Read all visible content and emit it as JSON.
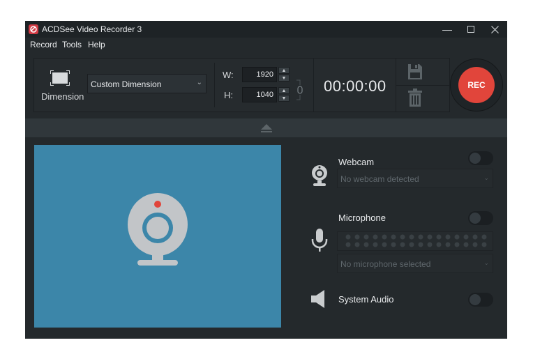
{
  "window": {
    "title": "ACDSee Video Recorder 3"
  },
  "menu": [
    "Record",
    "Tools",
    "Help"
  ],
  "toolbar": {
    "dimension_label": "Dimension",
    "dimension_value": "Custom Dimension",
    "width_label": "W:",
    "width_value": "1920",
    "height_label": "H:",
    "height_value": "1040",
    "timer": "00:00:00",
    "rec_label": "REC"
  },
  "sources": {
    "webcam": {
      "label": "Webcam",
      "dropdown": "No webcam detected",
      "enabled": false
    },
    "microphone": {
      "label": "Microphone",
      "dropdown": "No microphone selected",
      "enabled": false
    },
    "system_audio": {
      "label": "System Audio",
      "enabled": false
    }
  },
  "colors": {
    "accent_rec": "#e1453b",
    "preview_bg": "#3c86a9",
    "window_bg": "#24292c"
  }
}
